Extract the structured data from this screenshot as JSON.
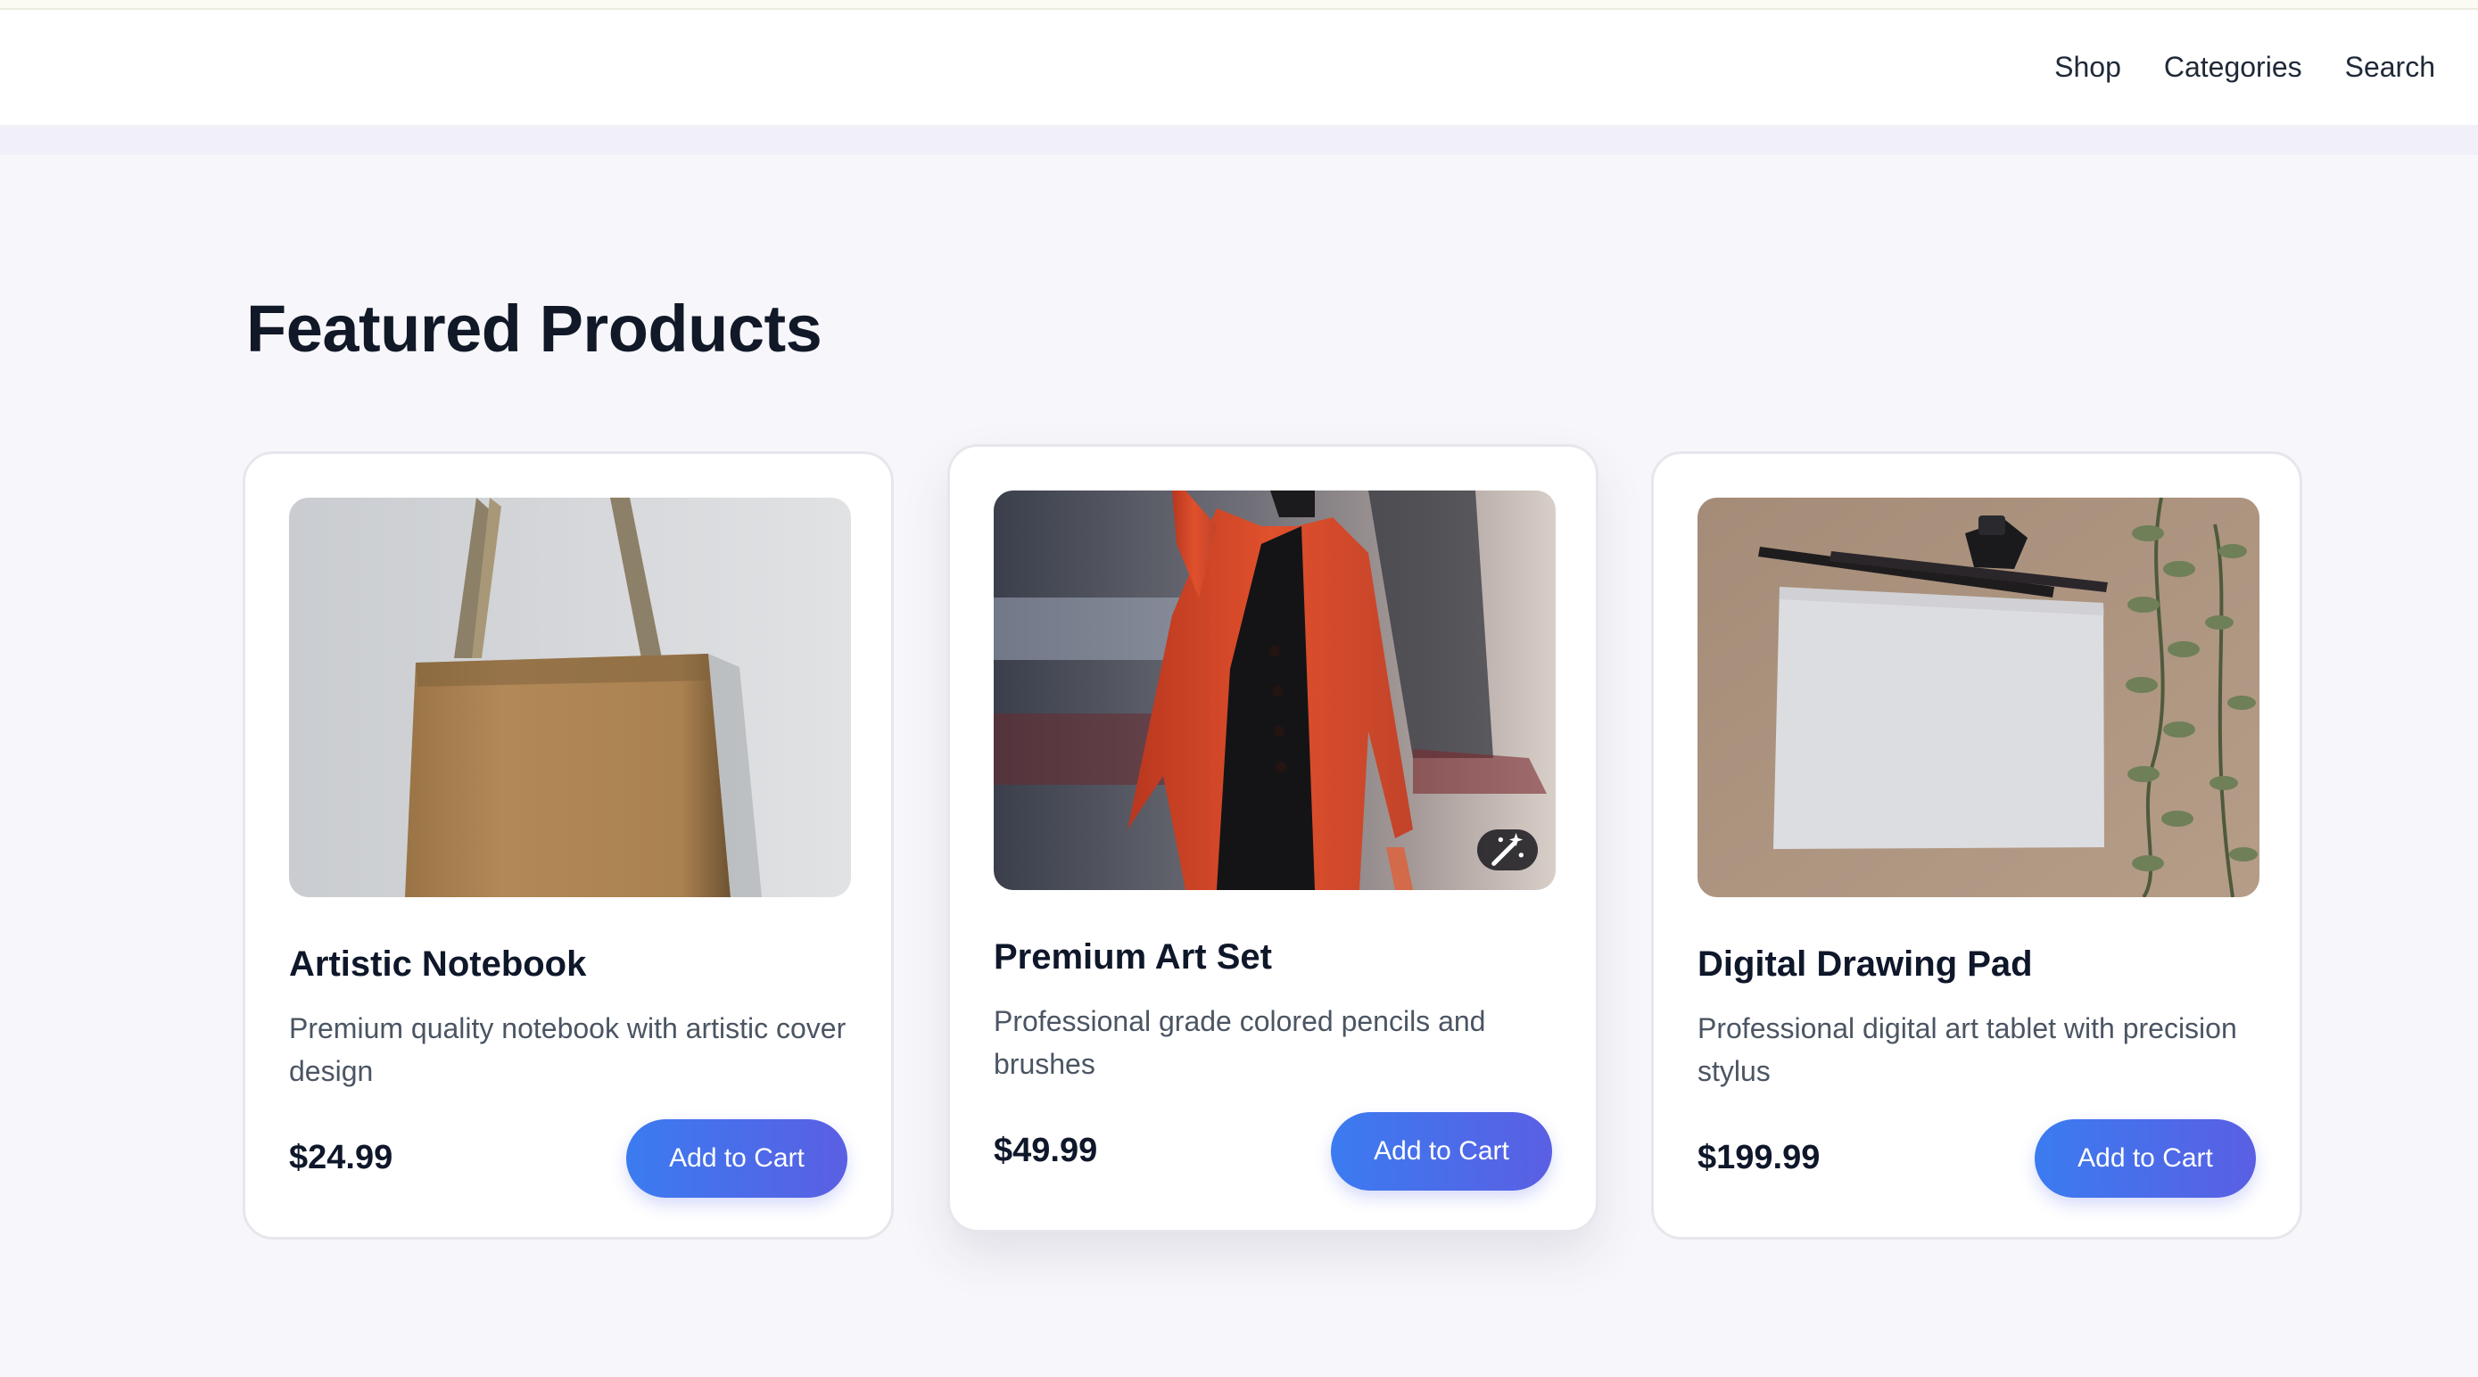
{
  "nav": {
    "links": [
      "Shop",
      "Categories",
      "Search"
    ]
  },
  "main": {
    "title": "Featured Products"
  },
  "products": [
    {
      "name": "Artistic Notebook",
      "description": "Premium quality notebook with artistic cover design",
      "price": "$24.99",
      "cta": "Add to Cart",
      "image": "brown-tote-bag-photo"
    },
    {
      "name": "Premium Art Set",
      "description": "Professional grade colored pencils and brushes",
      "price": "$49.99",
      "cta": "Add to Cart",
      "image": "woman-in-red-coat-photo",
      "badge_icon": "magic-wand-icon"
    },
    {
      "name": "Digital Drawing Pad",
      "description": "Professional digital art tablet with precision stylus",
      "price": "$199.99",
      "cta": "Add to Cart",
      "image": "paper-and-pens-photo"
    }
  ],
  "colors": {
    "accent_start": "#3b7bf0",
    "accent_end": "#5a5fe3",
    "page_bg": "#f7f7fb",
    "heading": "#111827",
    "body_text": "#4b5563"
  }
}
